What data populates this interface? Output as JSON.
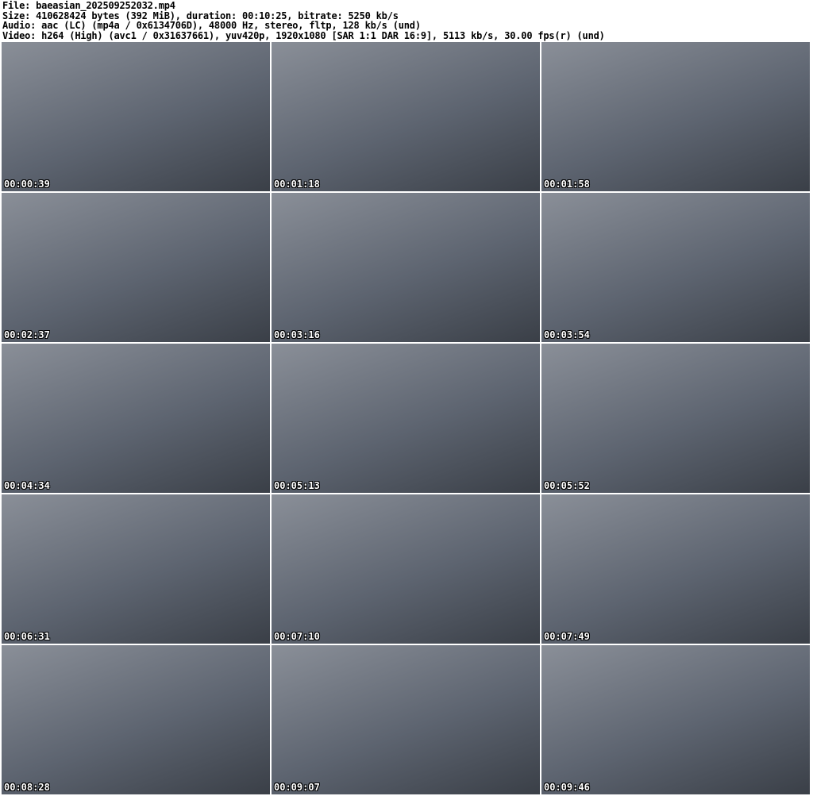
{
  "header": {
    "file": "File: baeasian_202509252032.mp4",
    "size": "Size: 410628424 bytes (392 MiB), duration: 00:10:25, bitrate: 5250 kb/s",
    "audio": "Audio: aac (LC) (mp4a / 0x6134706D), 48000 Hz, stereo, fltp, 128 kb/s (und)",
    "video": "Video: h264 (High) (avc1 / 0x31637661), yuv420p, 1920x1080 [SAR 1:1 DAR 16:9], 5113 kb/s, 30.00 fps(r) (und)"
  },
  "thumbnails": [
    {
      "timestamp": "00:00:39"
    },
    {
      "timestamp": "00:01:18"
    },
    {
      "timestamp": "00:01:58"
    },
    {
      "timestamp": "00:02:37"
    },
    {
      "timestamp": "00:03:16"
    },
    {
      "timestamp": "00:03:54"
    },
    {
      "timestamp": "00:04:34"
    },
    {
      "timestamp": "00:05:13"
    },
    {
      "timestamp": "00:05:52"
    },
    {
      "timestamp": "00:06:31"
    },
    {
      "timestamp": "00:07:10"
    },
    {
      "timestamp": "00:07:49"
    },
    {
      "timestamp": "00:08:28"
    },
    {
      "timestamp": "00:09:07"
    },
    {
      "timestamp": "00:09:46"
    }
  ]
}
